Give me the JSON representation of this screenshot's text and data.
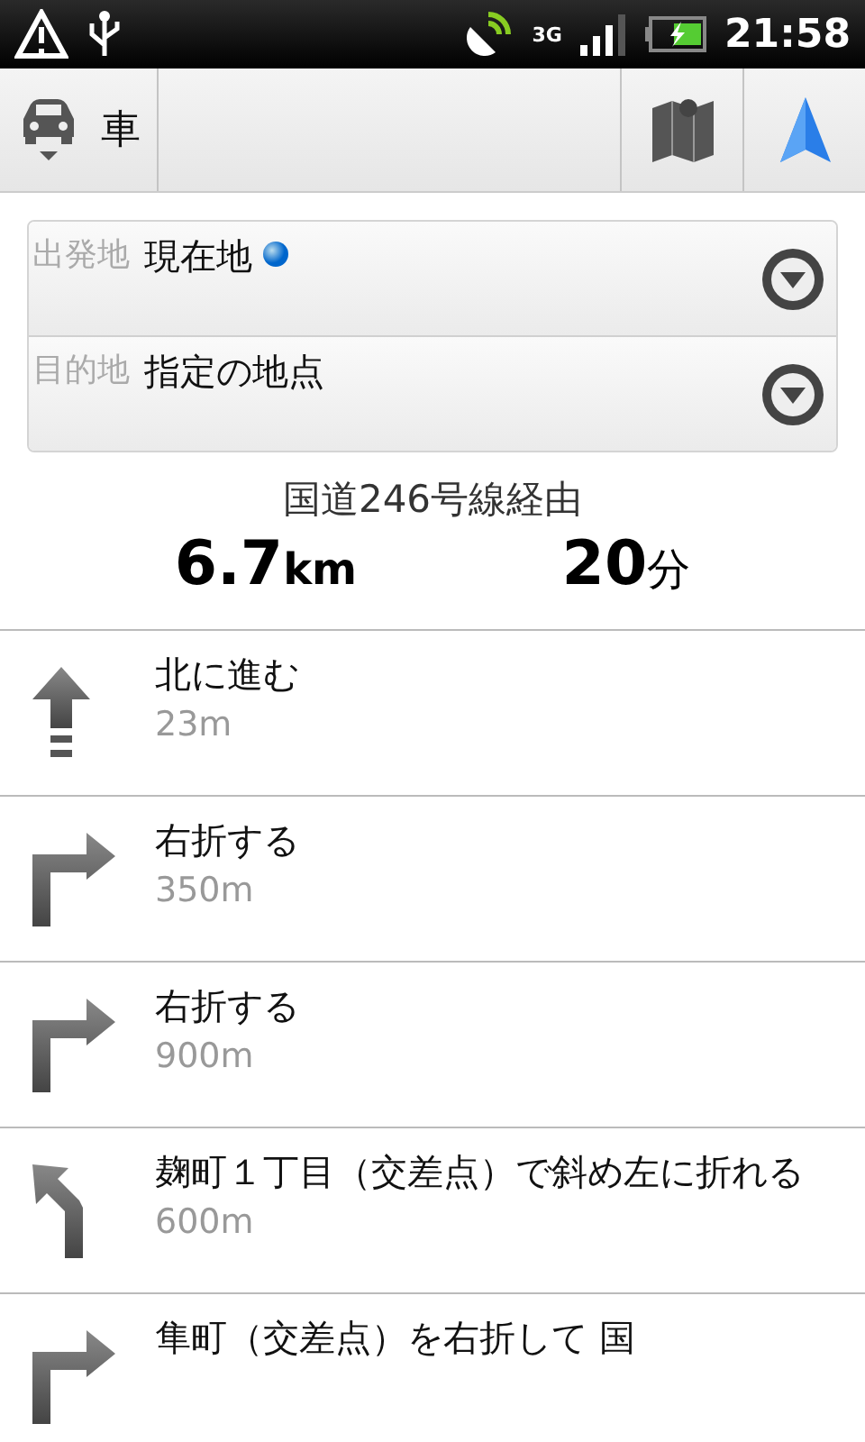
{
  "status_bar": {
    "network": "3G",
    "time": "21:58"
  },
  "toolbar": {
    "mode_label": "車"
  },
  "route_form": {
    "fields": [
      {
        "label": "出発地",
        "value": "現在地",
        "current_location": true
      },
      {
        "label": "目的地",
        "value": "指定の地点",
        "current_location": false
      }
    ]
  },
  "summary": {
    "via": "国道246号線経由",
    "distance": "6.7",
    "distance_unit": "km",
    "duration": "20",
    "duration_unit": "分"
  },
  "steps": [
    {
      "kind": "straight",
      "instruction": "北に進む",
      "distance": "23m"
    },
    {
      "kind": "right",
      "instruction": "右折する",
      "distance": "350m"
    },
    {
      "kind": "right",
      "instruction": "右折する",
      "distance": "900m"
    },
    {
      "kind": "slight_left",
      "instruction": "麹町１丁目（交差点）で斜め左に折れる",
      "distance": "600m"
    },
    {
      "kind": "right",
      "instruction": "隼町（交差点）を右折して 国"
    }
  ]
}
